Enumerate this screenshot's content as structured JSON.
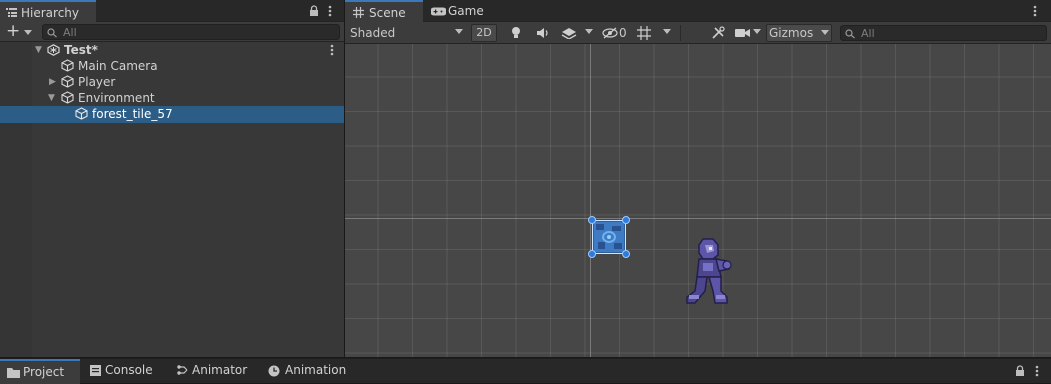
{
  "hierarchy": {
    "tab_label": "Hierarchy",
    "search_placeholder": "All",
    "add_label": "+",
    "scene_name": "Test*",
    "items": [
      {
        "label": "Main Camera",
        "icon": "cube-icon",
        "expander": "none"
      },
      {
        "label": "Player",
        "icon": "cube-icon",
        "expander": "collapsed"
      },
      {
        "label": "Environment",
        "icon": "cube-icon",
        "expander": "expanded"
      },
      {
        "label": "forest_tile_57",
        "icon": "cube-icon",
        "expander": "none",
        "selected": true
      }
    ]
  },
  "scene_view": {
    "tabs": [
      {
        "label": "Scene",
        "icon": "grid-icon",
        "active": true
      },
      {
        "label": "Game",
        "icon": "gamepad-icon",
        "active": false
      }
    ],
    "shading_mode": "Shaded",
    "mode_2d_label": "2D",
    "hidden_count": "0",
    "gizmos_label": "Gizmos",
    "search_placeholder": "All",
    "objects": [
      {
        "name": "forest_tile_57",
        "selected": true
      },
      {
        "name": "Player"
      }
    ]
  },
  "bottom_tabs": [
    {
      "label": "Project",
      "icon": "folder-icon",
      "active": true
    },
    {
      "label": "Console",
      "icon": "console-icon",
      "active": false
    },
    {
      "label": "Animator",
      "icon": "animator-icon",
      "active": false
    },
    {
      "label": "Animation",
      "icon": "clock-icon",
      "active": false
    }
  ],
  "colors": {
    "accent": "#3a79bb",
    "selection": "#2c5d87",
    "panel": "#383838",
    "viewport": "#474747"
  }
}
